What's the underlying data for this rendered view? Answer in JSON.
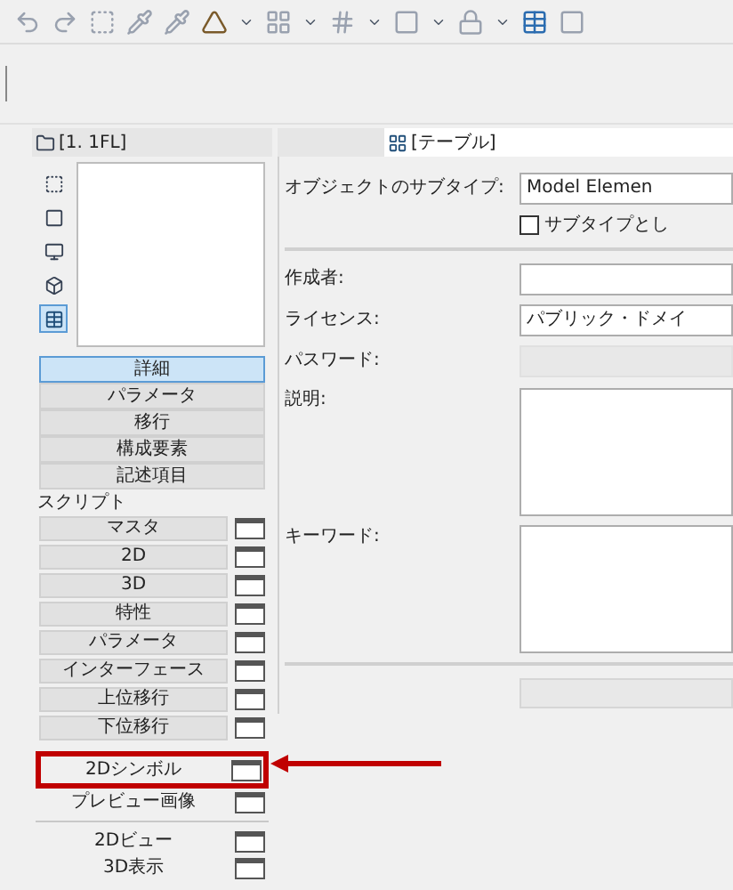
{
  "left_panel": {
    "tab_label": "[1. 1FL]",
    "view_icons": [
      {
        "kind": "dashed",
        "selected": false
      },
      {
        "kind": "square",
        "selected": false
      },
      {
        "kind": "monitor",
        "selected": false
      },
      {
        "kind": "cube",
        "selected": false
      },
      {
        "kind": "frame",
        "selected": true
      }
    ],
    "sections": [
      {
        "label": "詳細",
        "selected": true
      },
      {
        "label": "パラメータ",
        "selected": false
      },
      {
        "label": "移行",
        "selected": false
      },
      {
        "label": "構成要素",
        "selected": false
      },
      {
        "label": "記述項目",
        "selected": false
      }
    ],
    "script_heading": "スクリプト",
    "scripts": [
      {
        "label": "マスタ"
      },
      {
        "label": "2D"
      },
      {
        "label": "3D"
      },
      {
        "label": "特性"
      },
      {
        "label": "パラメータ"
      },
      {
        "label": "インターフェース"
      },
      {
        "label": "上位移行"
      },
      {
        "label": "下位移行"
      }
    ],
    "extra_scripts": [
      {
        "label": "2Dシンボル",
        "callout": true
      },
      {
        "label": "プレビュー画像",
        "callout": false
      }
    ],
    "views": [
      {
        "label": "2Dビュー"
      },
      {
        "label": "3D表示"
      }
    ]
  },
  "right_panel": {
    "tab_label": "[テーブル]",
    "rows": [
      {
        "kind": "dropdown",
        "label": "オブジェクトのサブタイプ:",
        "value": "Model Elemen"
      },
      {
        "kind": "checkbox",
        "label": "サブタイプとし",
        "checked": false
      },
      {
        "kind": "divider"
      },
      {
        "kind": "text",
        "label": "作成者:"
      },
      {
        "kind": "dropdown",
        "label": "ライセンス:",
        "value": "パブリック・ドメイ"
      },
      {
        "kind": "disabled",
        "label": "パスワード:"
      },
      {
        "kind": "textarea",
        "label": "説明:"
      },
      {
        "kind": "textarea",
        "label": "キーワード:"
      },
      {
        "kind": "divider"
      },
      {
        "kind": "button",
        "disabled": true
      }
    ]
  }
}
